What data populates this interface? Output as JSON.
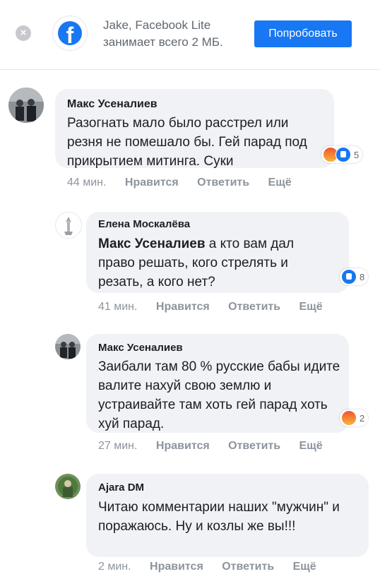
{
  "banner": {
    "close_glyph": "×",
    "logo_glyph": "f",
    "line1": "Jake, Facebook Lite",
    "line2": "занимает всего 2 МБ.",
    "button": "Попробовать"
  },
  "actions": {
    "like": "Нравится",
    "reply": "Ответить",
    "more": "Ещё"
  },
  "comments": [
    {
      "author": "Макс Усеналиев",
      "mention": "",
      "text": "Разогнать мало было расстрел или резня не помешало бы. Гей парад под прикрытием митинга. Суки",
      "time": "44 мин.",
      "reactions": [
        "angry",
        "like"
      ],
      "reaction_count": "5"
    },
    {
      "author": "Елена Москалёва",
      "mention": "Макс Усеналиев",
      "text": " а кто вам дал право решать, кого стрелять и резать, а кого нет?",
      "time": "41 мин.",
      "reactions": [
        "like"
      ],
      "reaction_count": "8"
    },
    {
      "author": "Макс Усеналиев",
      "mention": "",
      "text": "Заибали там 80 % русские бабы идите валите нахуй свою землю и устраивайте там хоть гей парад хоть хуй парад.",
      "time": "27 мин.",
      "reactions": [
        "angry"
      ],
      "reaction_count": "2"
    },
    {
      "author": "Ajara DM",
      "mention": "",
      "text": "Читаю комментарии наших \"мужчин\" и поражаюсь. Ну и козлы же вы!!!",
      "time": "2 мин.",
      "reactions": [],
      "reaction_count": ""
    }
  ],
  "colors": {
    "brand": "#1877f2",
    "bubble": "#f0f2f5",
    "meta": "#8d949e"
  }
}
